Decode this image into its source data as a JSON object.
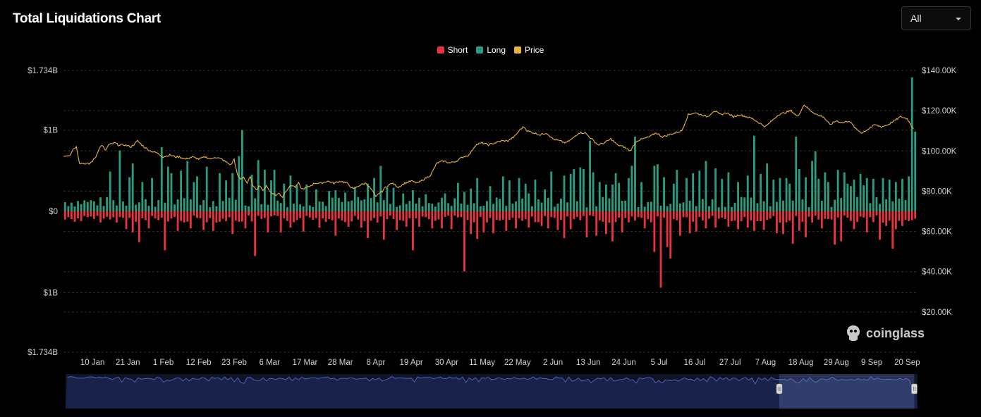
{
  "header": {
    "title": "Total Liquidations Chart",
    "range_select": {
      "value": "All"
    }
  },
  "brand": {
    "name": "coinglass"
  },
  "colors": {
    "short": "#e8343c",
    "long": "#2b9c82",
    "price": "#e8b33a",
    "navigator_fill": "#19234a",
    "navigator_line": "#4d63b8"
  },
  "chart_data": {
    "type": "bar",
    "legend": [
      {
        "key": "short",
        "label": "Short"
      },
      {
        "key": "long",
        "label": "Long"
      },
      {
        "key": "price",
        "label": "Price"
      }
    ],
    "left_axis": {
      "ticks": [
        {
          "value": 1.734,
          "label": "$1.734B"
        },
        {
          "value": 1.0,
          "label": "$1B"
        },
        {
          "value": 0,
          "label": "$0"
        },
        {
          "value": -1.0,
          "label": "$1B"
        },
        {
          "value": -1.734,
          "label": "$1.734B"
        }
      ],
      "range": [
        -1.734,
        1.734
      ]
    },
    "right_axis": {
      "ticks": [
        {
          "value": 140,
          "label": "$140.00K"
        },
        {
          "value": 120,
          "label": "$120.00K"
        },
        {
          "value": 100,
          "label": "$100.00K"
        },
        {
          "value": 80,
          "label": "$80.00K"
        },
        {
          "value": 60,
          "label": "$60.00K"
        },
        {
          "value": 40,
          "label": "$40.00K"
        },
        {
          "value": 20,
          "label": "$20.00K"
        }
      ],
      "range": [
        0,
        140
      ]
    },
    "x_ticks": [
      "10 Jan",
      "21 Jan",
      "1 Feb",
      "12 Feb",
      "23 Feb",
      "6 Mar",
      "17 Mar",
      "28 Mar",
      "8 Apr",
      "19 Apr",
      "30 Apr",
      "11 May",
      "22 May",
      "2 Jun",
      "13 Jun",
      "24 Jun",
      "5 Jul",
      "16 Jul",
      "27 Jul",
      "7 Aug",
      "18 Aug",
      "29 Aug",
      "9 Sep",
      "20 Sep"
    ],
    "x_tick_days": [
      9,
      20,
      31,
      42,
      53,
      64,
      75,
      86,
      97,
      108,
      119,
      130,
      141,
      152,
      163,
      174,
      185,
      196,
      207,
      218,
      229,
      240,
      251,
      262
    ],
    "day_range": [
      0,
      265
    ],
    "long_spikes": [
      [
        20,
        0.42
      ],
      [
        32,
        0.55
      ],
      [
        33,
        0.47
      ],
      [
        36,
        0.5
      ],
      [
        40,
        0.36
      ],
      [
        52,
        0.47
      ],
      [
        58,
        0.45
      ],
      [
        55,
        1.0
      ],
      [
        65,
        0.51
      ],
      [
        68,
        0.34
      ],
      [
        78,
        0.27
      ],
      [
        82,
        0.25
      ],
      [
        96,
        0.41
      ],
      [
        102,
        0.29
      ],
      [
        108,
        0.26
      ],
      [
        118,
        0.22
      ],
      [
        124,
        0.24
      ],
      [
        128,
        0.41
      ],
      [
        136,
        0.43
      ],
      [
        141,
        0.41
      ],
      [
        151,
        0.49
      ],
      [
        158,
        0.52
      ],
      [
        163,
        0.87
      ],
      [
        171,
        0.47
      ],
      [
        176,
        0.56
      ],
      [
        184,
        0.58
      ],
      [
        189,
        0.34
      ],
      [
        193,
        0.41
      ],
      [
        197,
        0.5
      ],
      [
        202,
        0.53
      ],
      [
        212,
        0.44
      ],
      [
        218,
        0.59
      ],
      [
        222,
        0.41
      ],
      [
        228,
        0.52
      ],
      [
        232,
        0.62
      ],
      [
        240,
        0.51
      ],
      [
        245,
        0.39
      ],
      [
        248,
        0.32
      ],
      [
        251,
        0.4
      ],
      [
        262,
        0.43
      ],
      [
        263,
        0.47
      ],
      [
        262.5,
        1.65
      ],
      [
        264,
        0.98
      ],
      [
        176.5,
        0.92
      ],
      [
        201.5,
        0.51
      ],
      [
        216,
        0.46
      ],
      [
        213.5,
        0.93
      ],
      [
        232.5,
        0.74
      ],
      [
        246.5,
        0.46
      ],
      [
        226.5,
        0.92
      ],
      [
        183,
        0.56
      ],
      [
        189.5,
        0.46
      ],
      [
        244,
        0.31
      ],
      [
        236,
        0.48
      ],
      [
        239.5,
        0.45
      ],
      [
        172,
        0.35
      ],
      [
        164,
        0.48
      ],
      [
        168,
        0.33
      ],
      [
        217.5,
        0.4
      ],
      [
        220,
        0.39
      ],
      [
        223.5,
        0.41
      ],
      [
        241.5,
        0.48
      ],
      [
        253.5,
        0.41
      ],
      [
        255.5,
        0.39
      ],
      [
        258,
        0.36
      ],
      [
        179,
        0.36
      ],
      [
        161,
        0.52
      ],
      [
        143,
        0.34
      ],
      [
        146,
        0.39
      ],
      [
        17,
        0.75
      ],
      [
        14,
        0.49
      ],
      [
        21,
        0.59
      ],
      [
        24,
        0.36
      ],
      [
        27,
        0.41
      ],
      [
        30,
        0.79
      ],
      [
        38,
        0.62
      ],
      [
        41,
        0.43
      ],
      [
        44,
        0.55
      ],
      [
        48,
        0.47
      ],
      [
        50,
        0.38
      ],
      [
        53.5,
        0.68
      ],
      [
        60,
        0.63
      ],
      [
        62,
        0.51
      ],
      [
        64,
        0.38
      ],
      [
        70,
        0.44
      ],
      [
        72,
        0.32
      ],
      [
        75,
        0.33
      ],
      [
        84,
        0.26
      ],
      [
        87,
        0.23
      ],
      [
        90,
        0.3
      ],
      [
        94,
        0.34
      ],
      [
        98,
        0.56
      ],
      [
        100,
        0.29
      ],
      [
        105,
        0.22
      ],
      [
        112,
        0.21
      ],
      [
        122,
        0.35
      ],
      [
        126,
        0.28
      ],
      [
        132,
        0.31
      ],
      [
        138,
        0.38
      ],
      [
        144,
        0.22
      ],
      [
        149,
        0.27
      ],
      [
        155,
        0.44
      ],
      [
        157,
        0.46
      ],
      [
        160,
        0.54
      ],
      [
        166,
        0.36
      ],
      [
        170,
        0.33
      ],
      [
        175,
        0.41
      ],
      [
        186,
        0.42
      ],
      [
        190,
        0.51
      ],
      [
        195,
        0.47
      ],
      [
        199,
        0.62
      ],
      [
        204,
        0.4
      ],
      [
        206,
        0.48
      ],
      [
        209,
        0.36
      ],
      [
        225,
        0.34
      ],
      [
        230,
        0.42
      ],
      [
        234,
        0.4
      ],
      [
        237,
        0.36
      ],
      [
        243,
        0.34
      ],
      [
        249,
        0.41
      ],
      [
        256,
        0.34
      ],
      [
        260,
        0.4
      ]
    ],
    "short_spikes": [
      [
        31,
        0.48
      ],
      [
        59,
        0.55
      ],
      [
        63,
        0.26
      ],
      [
        67,
        0.26
      ],
      [
        74,
        0.25
      ],
      [
        84,
        0.3
      ],
      [
        94,
        0.33
      ],
      [
        99,
        0.35
      ],
      [
        106,
        0.19
      ],
      [
        108,
        0.48
      ],
      [
        114,
        0.21
      ],
      [
        124,
        0.74
      ],
      [
        133,
        0.27
      ],
      [
        140,
        0.21
      ],
      [
        148,
        0.18
      ],
      [
        155,
        0.33
      ],
      [
        162,
        0.32
      ],
      [
        170,
        0.37
      ],
      [
        183,
        0.5
      ],
      [
        185,
        0.94
      ],
      [
        188,
        0.58
      ],
      [
        191,
        0.3
      ],
      [
        194,
        0.27
      ],
      [
        206,
        0.19
      ],
      [
        212,
        0.2
      ],
      [
        214,
        0.24
      ],
      [
        226,
        0.4
      ],
      [
        230,
        0.32
      ],
      [
        239,
        0.41
      ],
      [
        241,
        0.37
      ],
      [
        253,
        0.35
      ],
      [
        257,
        0.46
      ],
      [
        260,
        0.18
      ],
      [
        263,
        0.11
      ],
      [
        19,
        0.22
      ],
      [
        21,
        0.26
      ],
      [
        23,
        0.38
      ],
      [
        26,
        0.21
      ],
      [
        35,
        0.24
      ],
      [
        39,
        0.21
      ],
      [
        43,
        0.23
      ],
      [
        46,
        0.24
      ],
      [
        52,
        0.28
      ],
      [
        56,
        0.21
      ],
      [
        70,
        0.2
      ],
      [
        79,
        0.2
      ],
      [
        88,
        0.19
      ],
      [
        92,
        0.2
      ],
      [
        103,
        0.23
      ],
      [
        110,
        0.19
      ],
      [
        117,
        0.21
      ],
      [
        120,
        0.22
      ],
      [
        126,
        0.28
      ],
      [
        128,
        0.34
      ],
      [
        130,
        0.26
      ],
      [
        137,
        0.24
      ],
      [
        144,
        0.2
      ],
      [
        150,
        0.21
      ],
      [
        153,
        0.23
      ],
      [
        157,
        0.22
      ],
      [
        165,
        0.3
      ],
      [
        168,
        0.28
      ],
      [
        173,
        0.26
      ],
      [
        180,
        0.21
      ],
      [
        187,
        0.44
      ],
      [
        196,
        0.25
      ],
      [
        199,
        0.21
      ],
      [
        202,
        0.2
      ],
      [
        209,
        0.22
      ],
      [
        217,
        0.23
      ],
      [
        221,
        0.27
      ],
      [
        223,
        0.28
      ],
      [
        228,
        0.24
      ],
      [
        235,
        0.21
      ],
      [
        245,
        0.22
      ],
      [
        249,
        0.26
      ],
      [
        255,
        0.18
      ],
      [
        258,
        0.22
      ]
    ],
    "price_anchors": [
      [
        0,
        97.5
      ],
      [
        2,
        98
      ],
      [
        3,
        101
      ],
      [
        4,
        102
      ],
      [
        5,
        94
      ],
      [
        8,
        93.5
      ],
      [
        9,
        95
      ],
      [
        10,
        97
      ],
      [
        11,
        101
      ],
      [
        12,
        103
      ],
      [
        13,
        100
      ],
      [
        14,
        103
      ],
      [
        16,
        104
      ],
      [
        17,
        103
      ],
      [
        19,
        103
      ],
      [
        21,
        102
      ],
      [
        23,
        105
      ],
      [
        25,
        102
      ],
      [
        27,
        100
      ],
      [
        29,
        99
      ],
      [
        30,
        98
      ],
      [
        31,
        97
      ],
      [
        33,
        98
      ],
      [
        35,
        97
      ],
      [
        36,
        97
      ],
      [
        38,
        96
      ],
      [
        40,
        97
      ],
      [
        42,
        96
      ],
      [
        44,
        97
      ],
      [
        46,
        96
      ],
      [
        47,
        97
      ],
      [
        49,
        96
      ],
      [
        51,
        94
      ],
      [
        52,
        93
      ],
      [
        53,
        96
      ],
      [
        54,
        88
      ],
      [
        55,
        86
      ],
      [
        56,
        87
      ],
      [
        57,
        84
      ],
      [
        58,
        87
      ],
      [
        59,
        82
      ],
      [
        60,
        81
      ],
      [
        61,
        83
      ],
      [
        62,
        80
      ],
      [
        63,
        83
      ],
      [
        64,
        80
      ],
      [
        65,
        79
      ],
      [
        66,
        78
      ],
      [
        67,
        79
      ],
      [
        68,
        77
      ],
      [
        69,
        80
      ],
      [
        70,
        82
      ],
      [
        71,
        83
      ],
      [
        72,
        82
      ],
      [
        73,
        84
      ],
      [
        74,
        81
      ],
      [
        76,
        82
      ],
      [
        78,
        84
      ],
      [
        80,
        84
      ],
      [
        82,
        85
      ],
      [
        84,
        84
      ],
      [
        86,
        85
      ],
      [
        88,
        84
      ],
      [
        90,
        81
      ],
      [
        92,
        83
      ],
      [
        94,
        84
      ],
      [
        95,
        82
      ],
      [
        96,
        80
      ],
      [
        97,
        77
      ],
      [
        98,
        79
      ],
      [
        99,
        80
      ],
      [
        100,
        82
      ],
      [
        102,
        84
      ],
      [
        104,
        82
      ],
      [
        106,
        84
      ],
      [
        108,
        85
      ],
      [
        110,
        84
      ],
      [
        112,
        86
      ],
      [
        114,
        88
      ],
      [
        116,
        94
      ],
      [
        118,
        95
      ],
      [
        120,
        94
      ],
      [
        122,
        95
      ],
      [
        124,
        97
      ],
      [
        126,
        98
      ],
      [
        128,
        103
      ],
      [
        130,
        104
      ],
      [
        132,
        103
      ],
      [
        134,
        104
      ],
      [
        136,
        105
      ],
      [
        138,
        105
      ],
      [
        140,
        107
      ],
      [
        141,
        109
      ],
      [
        142,
        111
      ],
      [
        143,
        112
      ],
      [
        144,
        110
      ],
      [
        146,
        109
      ],
      [
        148,
        108
      ],
      [
        150,
        109
      ],
      [
        152,
        106
      ],
      [
        154,
        105
      ],
      [
        156,
        104
      ],
      [
        158,
        106
      ],
      [
        160,
        109
      ],
      [
        162,
        109
      ],
      [
        164,
        106
      ],
      [
        166,
        103
      ],
      [
        168,
        104
      ],
      [
        170,
        106
      ],
      [
        172,
        103
      ],
      [
        174,
        102
      ],
      [
        176,
        100
      ],
      [
        178,
        105
      ],
      [
        180,
        106
      ],
      [
        182,
        107
      ],
      [
        184,
        109
      ],
      [
        186,
        107
      ],
      [
        188,
        108
      ],
      [
        190,
        109
      ],
      [
        192,
        110
      ],
      [
        194,
        118
      ],
      [
        196,
        119
      ],
      [
        198,
        118
      ],
      [
        200,
        117
      ],
      [
        202,
        120
      ],
      [
        204,
        118
      ],
      [
        206,
        119
      ],
      [
        208,
        117
      ],
      [
        210,
        118
      ],
      [
        212,
        117
      ],
      [
        214,
        116
      ],
      [
        216,
        114
      ],
      [
        218,
        112
      ],
      [
        220,
        115
      ],
      [
        222,
        118
      ],
      [
        224,
        119
      ],
      [
        226,
        120
      ],
      [
        228,
        117
      ],
      [
        230,
        123
      ],
      [
        232,
        120
      ],
      [
        234,
        118
      ],
      [
        236,
        117
      ],
      [
        238,
        113
      ],
      [
        240,
        115
      ],
      [
        242,
        114
      ],
      [
        244,
        115
      ],
      [
        246,
        111
      ],
      [
        248,
        109
      ],
      [
        250,
        111
      ],
      [
        252,
        113
      ],
      [
        254,
        112
      ],
      [
        256,
        113
      ],
      [
        258,
        115
      ],
      [
        260,
        117
      ],
      [
        262,
        116
      ],
      [
        264,
        111
      ]
    ],
    "navigator": {
      "type": "area",
      "selection_days": [
        222,
        264
      ]
    }
  }
}
